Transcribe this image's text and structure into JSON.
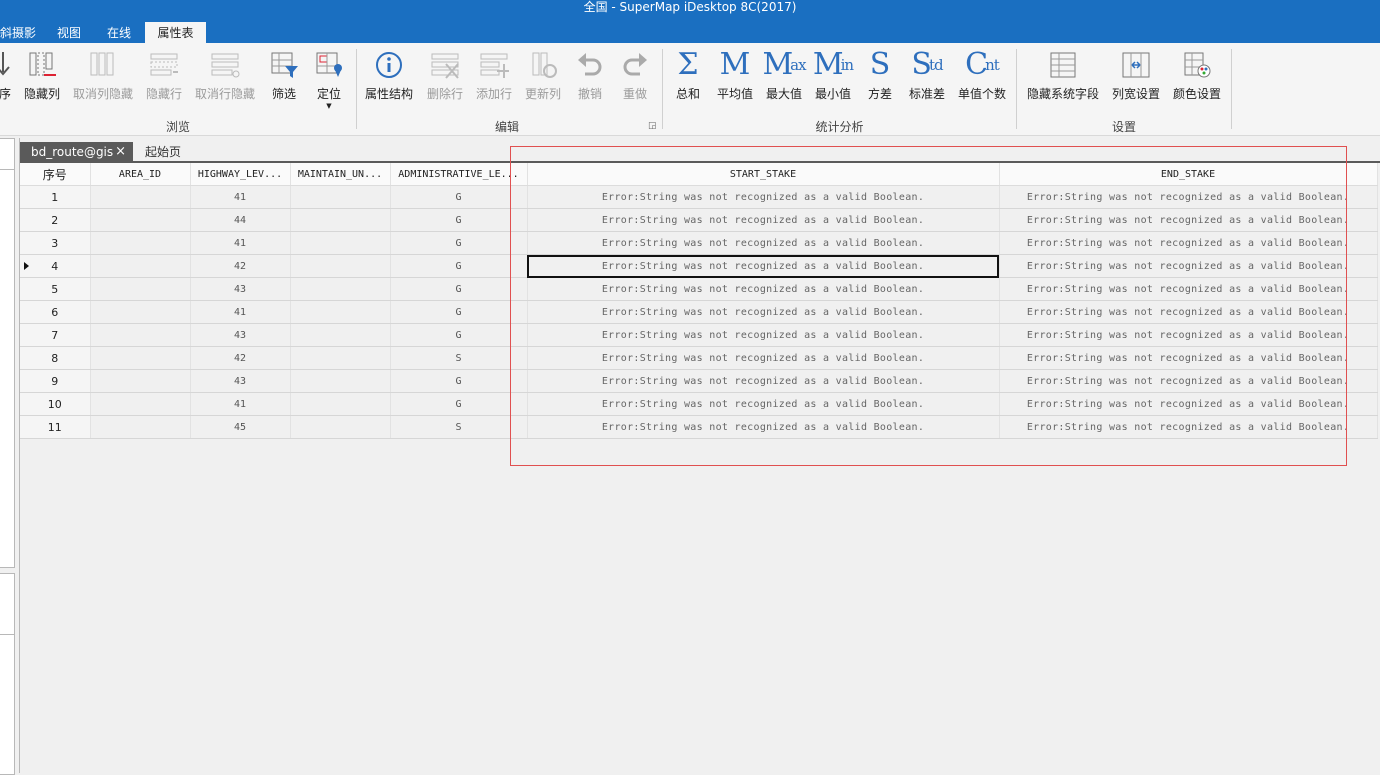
{
  "window": {
    "title": "全国 - SuperMap iDesktop 8C(2017)"
  },
  "menu": [
    "斜摄影",
    "视图",
    "在线",
    "属性表"
  ],
  "ribbon": {
    "browse": {
      "label": "浏览",
      "buttons": [
        "序",
        "隐藏列",
        "取消列隐藏",
        "隐藏行",
        "取消行隐藏",
        "筛选",
        "定位"
      ]
    },
    "edit": {
      "label": "编辑",
      "buttons": [
        "属性结构",
        "删除行",
        "添加行",
        "更新列",
        "撤销",
        "重做"
      ]
    },
    "stats": {
      "label": "统计分析",
      "buttons": [
        {
          "label": "总和",
          "glyph": "Σ",
          "sub": ""
        },
        {
          "label": "平均值",
          "glyph": "M",
          "sub": ""
        },
        {
          "label": "最大值",
          "glyph": "M",
          "sub": "ax"
        },
        {
          "label": "最小值",
          "glyph": "M",
          "sub": "in"
        },
        {
          "label": "方差",
          "glyph": "S",
          "sub": ""
        },
        {
          "label": "标准差",
          "glyph": "S",
          "sub": "td"
        },
        {
          "label": "单值个数",
          "glyph": "C",
          "sub": "nt"
        }
      ]
    },
    "settings": {
      "label": "设置",
      "buttons": [
        "隐藏系统字段",
        "列宽设置",
        "颜色设置"
      ]
    }
  },
  "tabs": {
    "active": "bd_route@gis",
    "close": "×",
    "start": "起始页"
  },
  "table": {
    "columns": [
      "序号",
      "AREA_ID",
      "HIGHWAY_LEV...",
      "MAINTAIN_UN...",
      "ADMINISTRATIVE_LE...",
      "START_STAKE",
      "END_STAKE"
    ],
    "error_text": "Error:String was not recognized as a valid Boolean.",
    "selected_row": 4,
    "rows": [
      {
        "seq": "1",
        "area_id": "",
        "highway_level": "41",
        "maintain_unit": "",
        "admin_level": "G"
      },
      {
        "seq": "2",
        "area_id": "",
        "highway_level": "44",
        "maintain_unit": "",
        "admin_level": "G"
      },
      {
        "seq": "3",
        "area_id": "",
        "highway_level": "41",
        "maintain_unit": "",
        "admin_level": "G"
      },
      {
        "seq": "4",
        "area_id": "",
        "highway_level": "42",
        "maintain_unit": "",
        "admin_level": "G"
      },
      {
        "seq": "5",
        "area_id": "",
        "highway_level": "43",
        "maintain_unit": "",
        "admin_level": "G"
      },
      {
        "seq": "6",
        "area_id": "",
        "highway_level": "41",
        "maintain_unit": "",
        "admin_level": "G"
      },
      {
        "seq": "7",
        "area_id": "",
        "highway_level": "43",
        "maintain_unit": "",
        "admin_level": "G"
      },
      {
        "seq": "8",
        "area_id": "",
        "highway_level": "42",
        "maintain_unit": "",
        "admin_level": "S"
      },
      {
        "seq": "9",
        "area_id": "",
        "highway_level": "43",
        "maintain_unit": "",
        "admin_level": "G"
      },
      {
        "seq": "10",
        "area_id": "",
        "highway_level": "41",
        "maintain_unit": "",
        "admin_level": "G"
      },
      {
        "seq": "11",
        "area_id": "",
        "highway_level": "45",
        "maintain_unit": "",
        "admin_level": "S"
      }
    ]
  }
}
